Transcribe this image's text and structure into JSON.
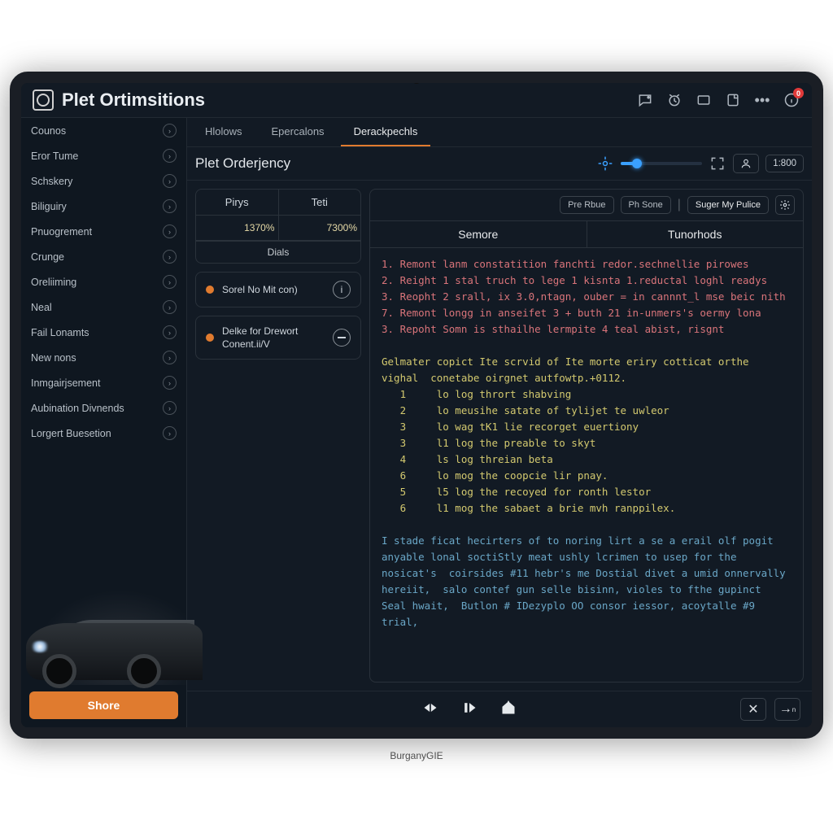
{
  "app_title": "Plet Ortimsitions",
  "hinge_label": "BurganyGIE",
  "titlebar": {
    "badge": "0"
  },
  "sidebar": {
    "items": [
      {
        "label": "Counos"
      },
      {
        "label": "Eror Tume"
      },
      {
        "label": "Schskery"
      },
      {
        "label": "Biliguiry"
      },
      {
        "label": "Pnuogrement"
      },
      {
        "label": "Crunge"
      },
      {
        "label": "Oreliiming"
      },
      {
        "label": "Neal"
      },
      {
        "label": "Fail Lonamts"
      },
      {
        "label": "New nons"
      },
      {
        "label": "Inmgairjsement"
      },
      {
        "label": "Aubination Divnends"
      },
      {
        "label": "Lorgert Buesetion"
      }
    ],
    "share_label": "Shore"
  },
  "tabs": [
    {
      "label": "Hlolows"
    },
    {
      "label": "Epercalons"
    },
    {
      "label": "Derackpechls",
      "active": true
    }
  ],
  "secondary": {
    "title": "Plet Orderjency",
    "user_chip": "",
    "value_chip": "1:800"
  },
  "leftcol": {
    "table": {
      "headers": [
        "Pirys",
        "Teti"
      ],
      "row": [
        "1370%",
        "7300%"
      ],
      "footer_label": "Dials"
    },
    "cards": [
      {
        "text": "Sorel No Mit con)",
        "icon": "info"
      },
      {
        "text": "Delke for Drewort Conent.ii/V",
        "icon": "minus"
      }
    ]
  },
  "rightcol": {
    "actions": {
      "prev": "Pre Rbue",
      "pause": "Ph Sone",
      "main": "Suger My Pulice"
    },
    "headers": [
      "Semore",
      "Tunorhods"
    ],
    "lines_red": [
      "1. Remont lanm constatition fanchti redor.sechnellie pirowes",
      "2. Reight 1 stal truch to lege 1 kisnta 1.reductal loghl readys",
      "3. Reopht 2 srall, ix 3.0,ntagn, ouber = in cannnt_l mse beic nith",
      "7. Remont longg in anseifet 3 + buth 21 in-unmers's oermy lona",
      "3. Repoht Somn is sthailhe lermpite 4 teal abist, risgnt"
    ],
    "block_yel_intro": "Gelmater copict Ite scrvid of Ite morte eriry cotticat orthe vighal  conetabe oirgnet autfowtp.+0112.",
    "block_yel_rows": [
      {
        "n": "1",
        "n2": "lo",
        "t": "log thrort shabving"
      },
      {
        "n": "2",
        "n2": "lo",
        "t": "meusihe satate of tylijet te uwleor"
      },
      {
        "n": "3",
        "n2": "lo",
        "t": "wag tK1 lie recorget euertiony"
      },
      {
        "n": "3",
        "n2": "l1",
        "t": "log the preable to skyt"
      },
      {
        "n": "4",
        "n2": "ls",
        "t": "log threian beta"
      },
      {
        "n": "6",
        "n2": "lo",
        "t": "mog the coopcie lir pnay."
      },
      {
        "n": "5",
        "n2": "l5",
        "t": "log the recoyed for ronth lestor"
      },
      {
        "n": "6",
        "n2": "l1",
        "t": "mog the sabaet a brie mvh ranppilex."
      }
    ],
    "block_blue": "I stade ficat hecirters of to noring lirt a se a erail olf pogit  anyable lonal soctiStly meat ushly lcrimen to usep for the nosicat's  coirsides #11 hebr's me Dostial divet a umid onnervally hereiit,  salo contef gun selle bisinn, violes to fthe gupinct Seal hwait,  Butlon # IDezyplo OO consor iessor, acoytalle #9 trial,"
  }
}
